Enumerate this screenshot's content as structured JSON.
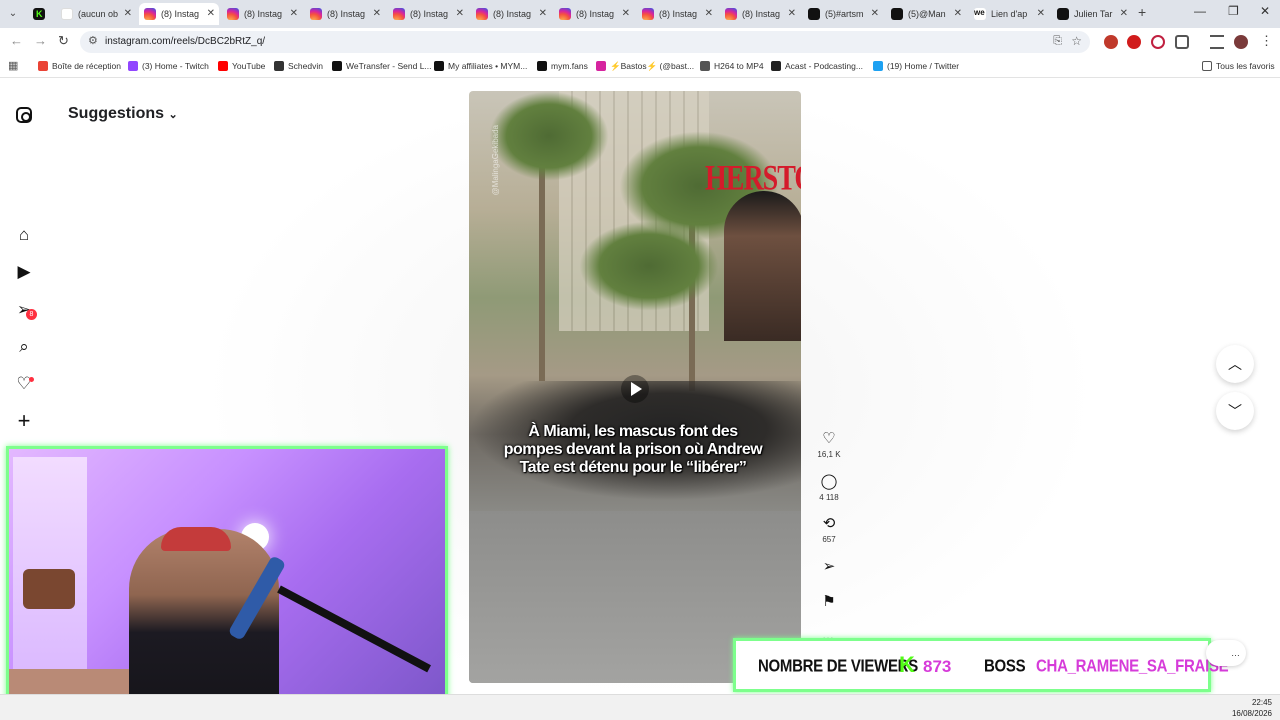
{
  "browser": {
    "tabs": [
      {
        "label": "",
        "icon": "kick-icon"
      },
      {
        "label": "(aucun ob",
        "icon": "gmail-icon"
      },
      {
        "label": "(8) Instag",
        "icon": "instagram-icon",
        "active": true
      },
      {
        "label": "(8) Instag",
        "icon": "instagram-icon"
      },
      {
        "label": "(8) Instag",
        "icon": "instagram-icon"
      },
      {
        "label": "(8) Instag",
        "icon": "instagram-icon"
      },
      {
        "label": "(8) Instag",
        "icon": "instagram-icon"
      },
      {
        "label": "(8) Instag",
        "icon": "instagram-icon"
      },
      {
        "label": "(8) Instag",
        "icon": "instagram-icon"
      },
      {
        "label": "(8) Instag",
        "icon": "instagram-icon"
      },
      {
        "label": "(5)#artsm",
        "icon": "tiktok-icon"
      },
      {
        "label": "(5)@Man",
        "icon": "tiktok-icon"
      },
      {
        "label": "Lien d'ap",
        "icon": "wetransfer-icon"
      },
      {
        "label": "Julien Tar",
        "icon": "tiktok-icon"
      }
    ],
    "url": "instagram.com/reels/DcBC2bRtZ_q/",
    "bookmarks": [
      {
        "label": "Boîte de réception",
        "icon": "gmail-icon"
      },
      {
        "label": "(3) Home - Twitch",
        "icon": "twitch-icon"
      },
      {
        "label": "YouTube",
        "icon": "youtube-icon"
      },
      {
        "label": "Schedvin",
        "icon": "dash-icon"
      },
      {
        "label": "WeTransfer - Send L...",
        "icon": "wetransfer-icon"
      },
      {
        "label": "My affiliates • MYM...",
        "icon": "mym-icon"
      },
      {
        "label": "mym.fans",
        "icon": "mym-icon"
      },
      {
        "label": "⚡Bastos⚡ (@bast...",
        "icon": "instagram-icon"
      },
      {
        "label": "H264 to MP4",
        "icon": "globe-icon"
      },
      {
        "label": "Acast - Podcasting...",
        "icon": "acast-icon"
      },
      {
        "label": "(19) Home / Twitter",
        "icon": "twitter-icon"
      }
    ],
    "all_bookmarks": "Tous les favoris"
  },
  "instagram": {
    "header": "Suggestions",
    "notification_count": "8",
    "reel": {
      "watermark": "@MalingaGekibada",
      "brand": "HERSTORY",
      "caption": "À Miami, les mascus font des pompes devant la prison où Andrew Tate est détenu pour le “libérer”",
      "likes": "16,1 K",
      "comments": "4 118",
      "reposts": "657"
    }
  },
  "stream_overlay": {
    "viewers_label": "NOMBRE DE VIEWERS",
    "viewers_count": "873",
    "boss_label": "BOSS",
    "boss_name": "CHA_RAMENE_SA_FRAISE"
  },
  "taskbar": {
    "time": "22:45",
    "date": "16/08/2026"
  },
  "colors": {
    "kick_green": "#53fc18",
    "overlay_pink": "#d63bd9",
    "frame_green": "#7dff8c",
    "brand_red": "#d41b2b"
  }
}
